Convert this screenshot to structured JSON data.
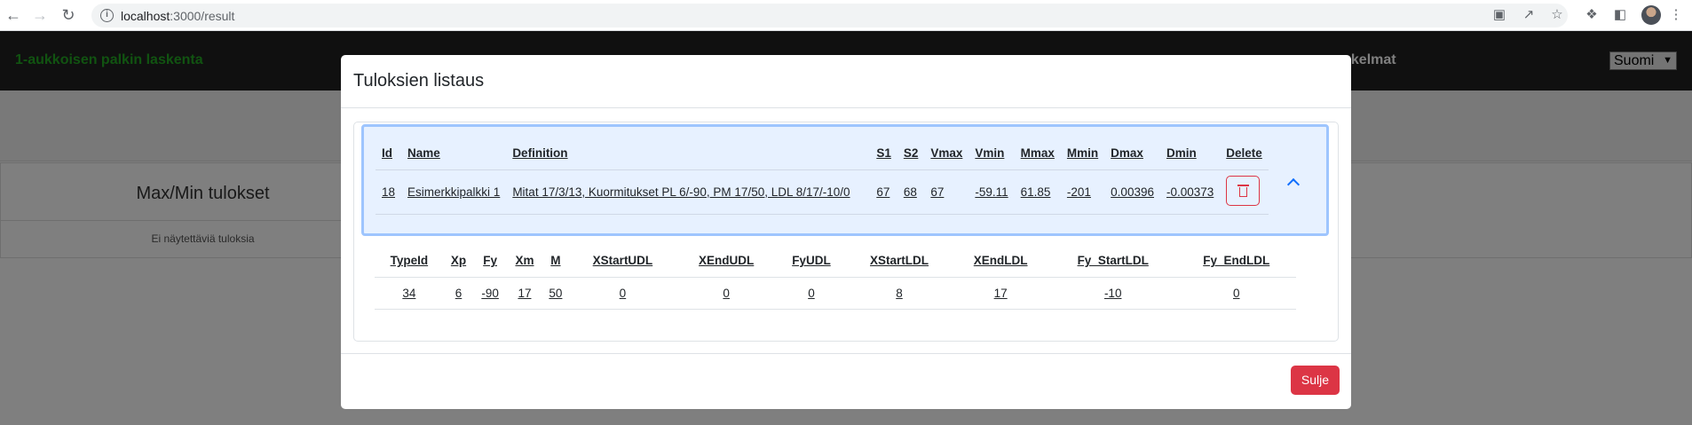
{
  "browser": {
    "url_host": "localhost",
    "url_path": ":3000/result"
  },
  "app": {
    "brand": "1-aukkoisen palkin laskenta",
    "nav_right_partial": "skelmat",
    "language": "Suomi",
    "maxmin_title": "Max/Min tulokset",
    "no_results": "Ei näytettäviä tuloksia"
  },
  "modal": {
    "title": "Tuloksien listaus",
    "close_label": "Sulje",
    "main_table": {
      "headers": [
        "Id",
        "Name",
        "Definition",
        "S1",
        "S2",
        "Vmax",
        "Vmin",
        "Mmax",
        "Mmin",
        "Dmax",
        "Dmin",
        "Delete"
      ],
      "row": [
        "18",
        "Esimerkkipalkki 1",
        "Mitat 17/3/13, Kuormitukset PL 6/-90, PM 17/50, LDL 8/17/-10/0",
        "67",
        "68",
        "67",
        "-59.11",
        "61.85",
        "-201",
        "0.00396",
        "-0.00373"
      ]
    },
    "detail_table": {
      "headers": [
        "TypeId",
        "Xp",
        "Fy",
        "Xm",
        "M",
        "XStartUDL",
        "XEndUDL",
        "FyUDL",
        "XStartLDL",
        "XEndLDL",
        "Fy_StartLDL",
        "Fy_EndLDL"
      ],
      "row": [
        "34",
        "6",
        "-90",
        "17",
        "50",
        "0",
        "0",
        "0",
        "8",
        "17",
        "-10",
        "0"
      ]
    }
  },
  "colors": {
    "brand": "#22a722",
    "danger": "#dc3545",
    "accordion_bg": "#e7f1ff",
    "accordion_border": "#9ec5fe"
  }
}
